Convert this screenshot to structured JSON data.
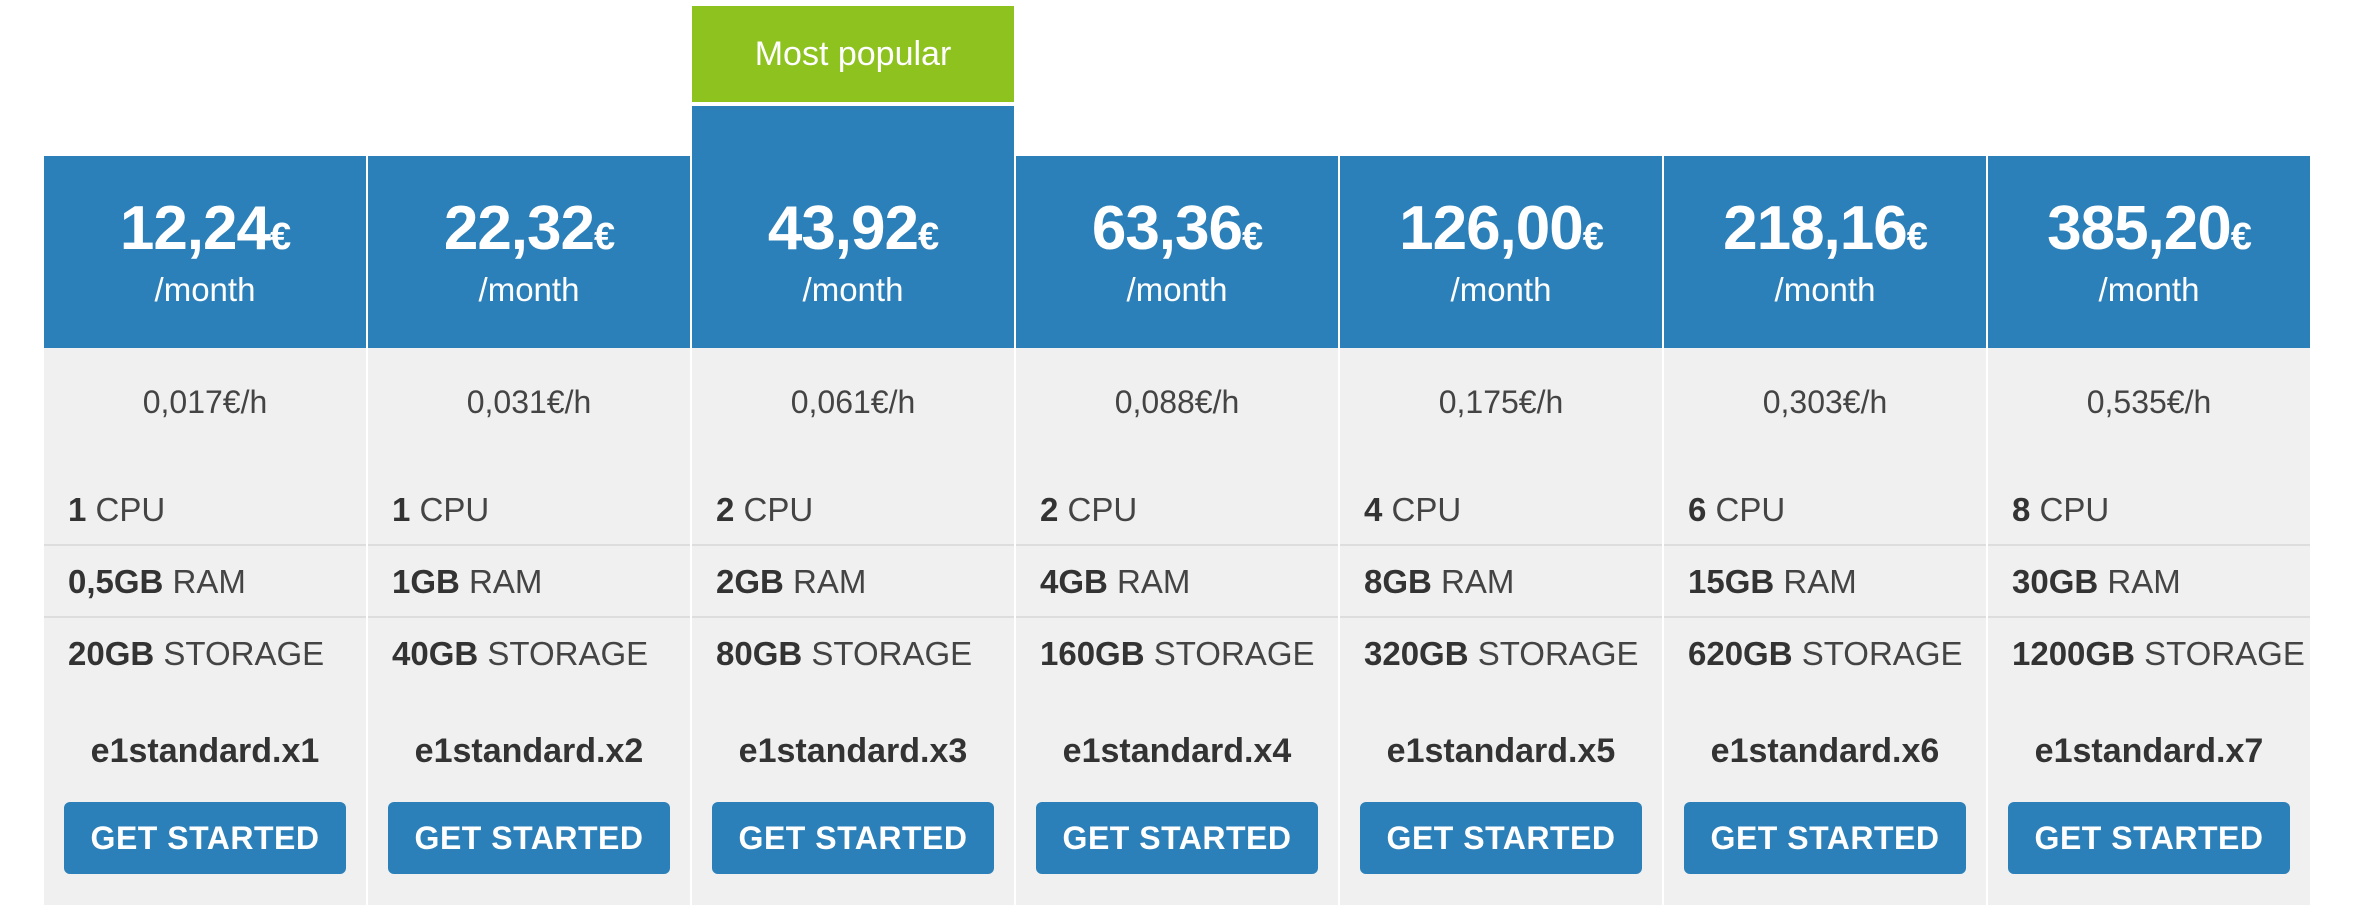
{
  "badge_label": "Most popular",
  "colors": {
    "primary": "#2c80b9",
    "badge": "#8dc21f",
    "card_background": "#f0f0f0"
  },
  "plans": [
    {
      "price": "12,24",
      "currency": "€",
      "period": "/month",
      "hourly": "0,017€/h",
      "cpu_value": "1",
      "cpu_label": "CPU",
      "ram_value": "0,5GB",
      "ram_label": "RAM",
      "storage_value": "20GB",
      "storage_label": "STORAGE",
      "name": "e1standard.x1",
      "cta": "GET STARTED"
    },
    {
      "price": "22,32",
      "currency": "€",
      "period": "/month",
      "hourly": "0,031€/h",
      "cpu_value": "1",
      "cpu_label": "CPU",
      "ram_value": "1GB",
      "ram_label": "RAM",
      "storage_value": "40GB",
      "storage_label": "STORAGE",
      "name": "e1standard.x2",
      "cta": "GET STARTED"
    },
    {
      "price": "43,92",
      "currency": "€",
      "period": "/month",
      "hourly": "0,061€/h",
      "cpu_value": "2",
      "cpu_label": "CPU",
      "ram_value": "2GB",
      "ram_label": "RAM",
      "storage_value": "80GB",
      "storage_label": "STORAGE",
      "name": "e1standard.x3",
      "cta": "GET STARTED"
    },
    {
      "price": "63,36",
      "currency": "€",
      "period": "/month",
      "hourly": "0,088€/h",
      "cpu_value": "2",
      "cpu_label": "CPU",
      "ram_value": "4GB",
      "ram_label": "RAM",
      "storage_value": "160GB",
      "storage_label": "STORAGE",
      "name": "e1standard.x4",
      "cta": "GET STARTED"
    },
    {
      "price": "126,00",
      "currency": "€",
      "period": "/month",
      "hourly": "0,175€/h",
      "cpu_value": "4",
      "cpu_label": "CPU",
      "ram_value": "8GB",
      "ram_label": "RAM",
      "storage_value": "320GB",
      "storage_label": "STORAGE",
      "name": "e1standard.x5",
      "cta": "GET STARTED"
    },
    {
      "price": "218,16",
      "currency": "€",
      "period": "/month",
      "hourly": "0,303€/h",
      "cpu_value": "6",
      "cpu_label": "CPU",
      "ram_value": "15GB",
      "ram_label": "RAM",
      "storage_value": "620GB",
      "storage_label": "STORAGE",
      "name": "e1standard.x6",
      "cta": "GET STARTED"
    },
    {
      "price": "385,20",
      "currency": "€",
      "period": "/month",
      "hourly": "0,535€/h",
      "cpu_value": "8",
      "cpu_label": "CPU",
      "ram_value": "30GB",
      "ram_label": "RAM",
      "storage_value": "1200GB",
      "storage_label": "STORAGE",
      "name": "e1standard.x7",
      "cta": "GET STARTED"
    }
  ]
}
